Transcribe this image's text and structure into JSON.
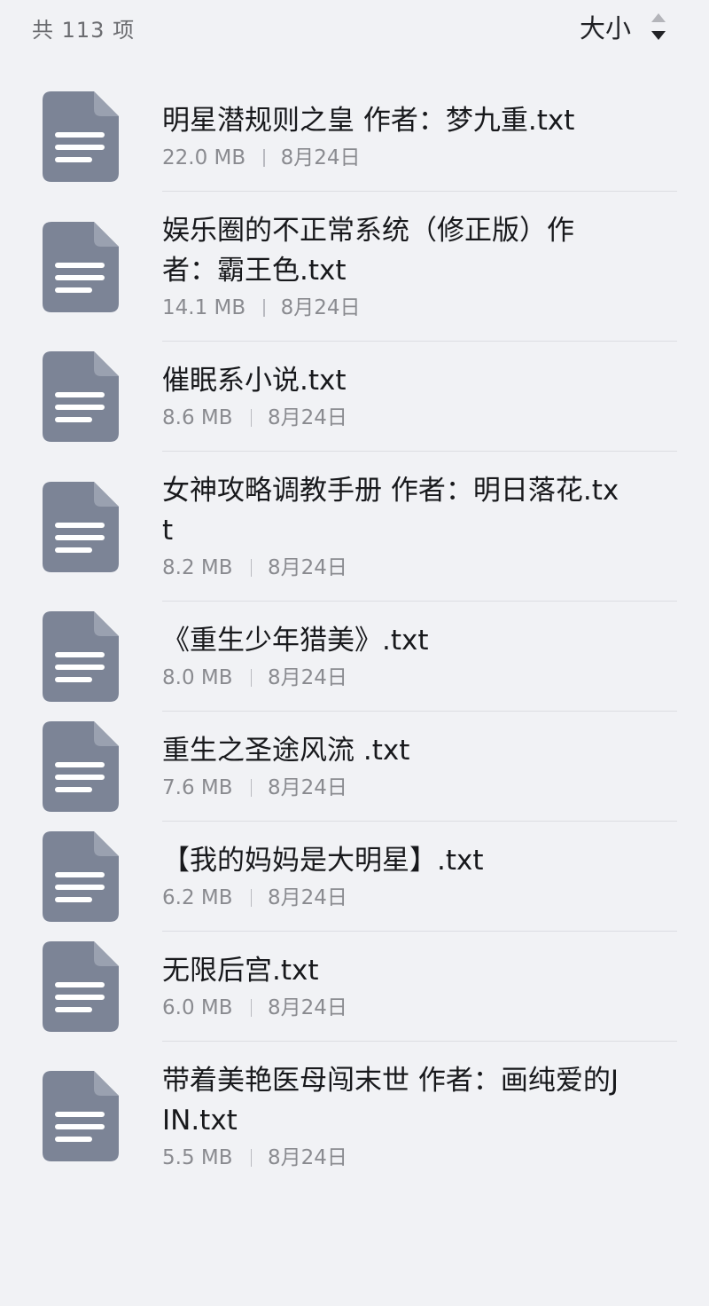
{
  "header": {
    "count_label": "共 113 项",
    "sort_label": "大小",
    "sort_icon": "sort-descending-icon"
  },
  "file_icon": "document-icon",
  "colors": {
    "background": "#f1f2f5",
    "icon_fill": "#7c8496",
    "divider": "#dcdde2"
  },
  "files": [
    {
      "name": "明星潜规则之皇 作者：梦九重.txt",
      "size": "22.0 MB",
      "date": "8月24日"
    },
    {
      "name": "娱乐圈的不正常系统（修正版）作者：霸王色.txt",
      "size": "14.1 MB",
      "date": "8月24日"
    },
    {
      "name": "催眠系小说.txt",
      "size": "8.6 MB",
      "date": "8月24日"
    },
    {
      "name": "女神攻略调教手册 作者：明日落花.txt",
      "size": "8.2 MB",
      "date": "8月24日"
    },
    {
      "name": "《重生少年猎美》.txt",
      "size": "8.0 MB",
      "date": "8月24日"
    },
    {
      "name": "重生之圣途风流 .txt",
      "size": "7.6 MB",
      "date": "8月24日"
    },
    {
      "name": "【我的妈妈是大明星】.txt",
      "size": "6.2 MB",
      "date": "8月24日"
    },
    {
      "name": "无限后宫.txt",
      "size": "6.0 MB",
      "date": "8月24日"
    },
    {
      "name": "带着美艳医母闯末世 作者：画纯爱的JIN.txt",
      "size": "5.5 MB",
      "date": "8月24日"
    }
  ]
}
